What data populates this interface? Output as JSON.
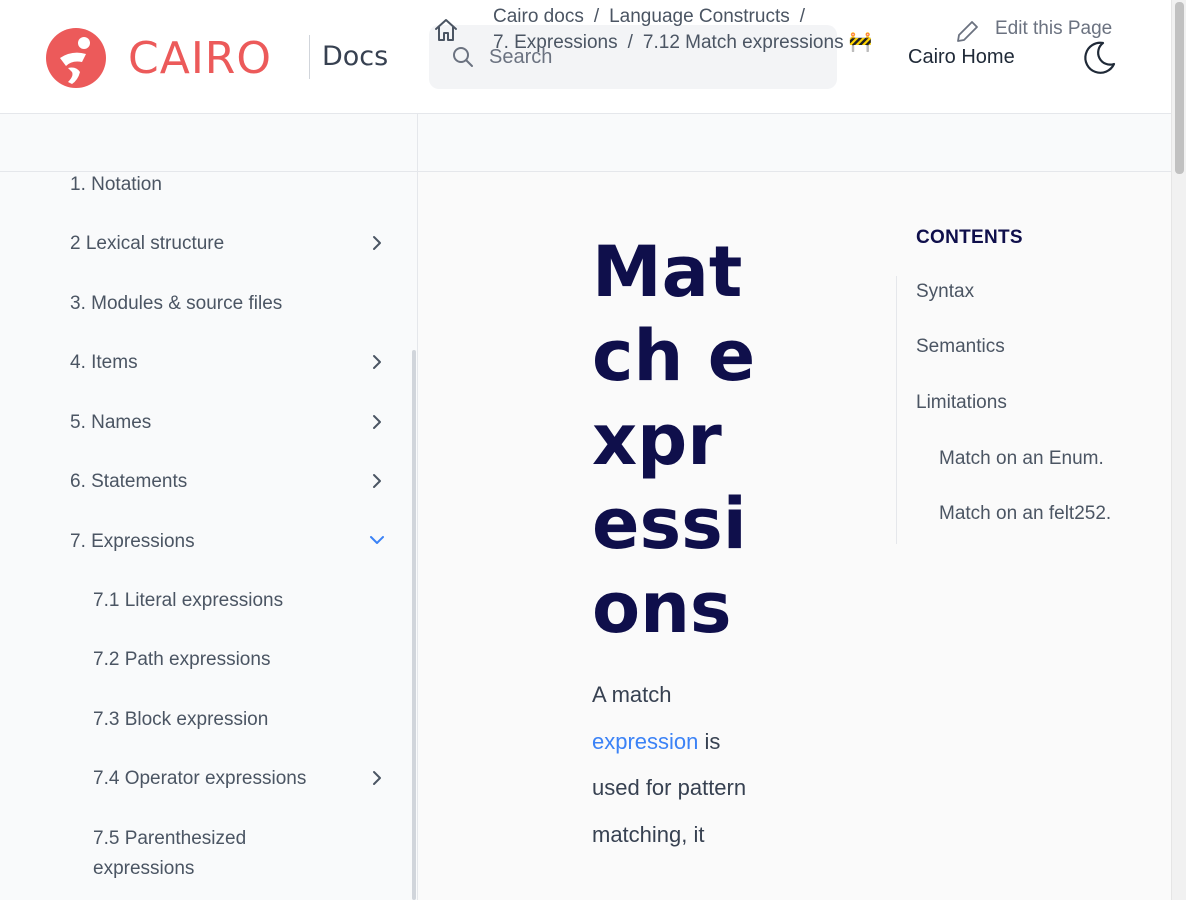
{
  "header": {
    "brand": "CAIRO",
    "docs_label": "Docs",
    "search_placeholder": "Search",
    "home_link": "Cairo Home"
  },
  "breadcrumb": {
    "items": [
      "Cairo docs",
      "Language Constructs",
      "7. Expressions",
      "7.12 Match expressions 🚧"
    ],
    "separator": "/",
    "edit_label": "Edit this Page"
  },
  "sidebar": {
    "items": [
      {
        "label": "1. Notation",
        "expandable": false
      },
      {
        "label": "2 Lexical structure",
        "expandable": true
      },
      {
        "label": "3. Modules & source files",
        "expandable": false
      },
      {
        "label": "4. Items",
        "expandable": true
      },
      {
        "label": "5. Names",
        "expandable": true
      },
      {
        "label": "6. Statements",
        "expandable": true
      },
      {
        "label": "7. Expressions",
        "expandable": true,
        "expanded": true
      },
      {
        "label": "7.1 Literal expressions",
        "expandable": false
      },
      {
        "label": "7.2 Path expressions",
        "expandable": false
      },
      {
        "label": "7.3 Block expression",
        "expandable": false
      },
      {
        "label": "7.4 Operator expressions",
        "expandable": true
      },
      {
        "label": "7.5 Parenthesized expressions",
        "expandable": false
      }
    ]
  },
  "main": {
    "title": "Match expressions",
    "intro_before": "A match",
    "intro_link": "expression",
    "intro_after": " is used for pattern matching, it"
  },
  "toc": {
    "title": "CONTENTS",
    "items": [
      "Syntax",
      "Semantics",
      "Limitations",
      "Match on an Enum.",
      "Match on an felt252."
    ]
  },
  "colors": {
    "brand": "#ec5a5a",
    "title": "#0f0f4b",
    "link": "#3b82f6",
    "chevron_active": "#3b82f6"
  }
}
